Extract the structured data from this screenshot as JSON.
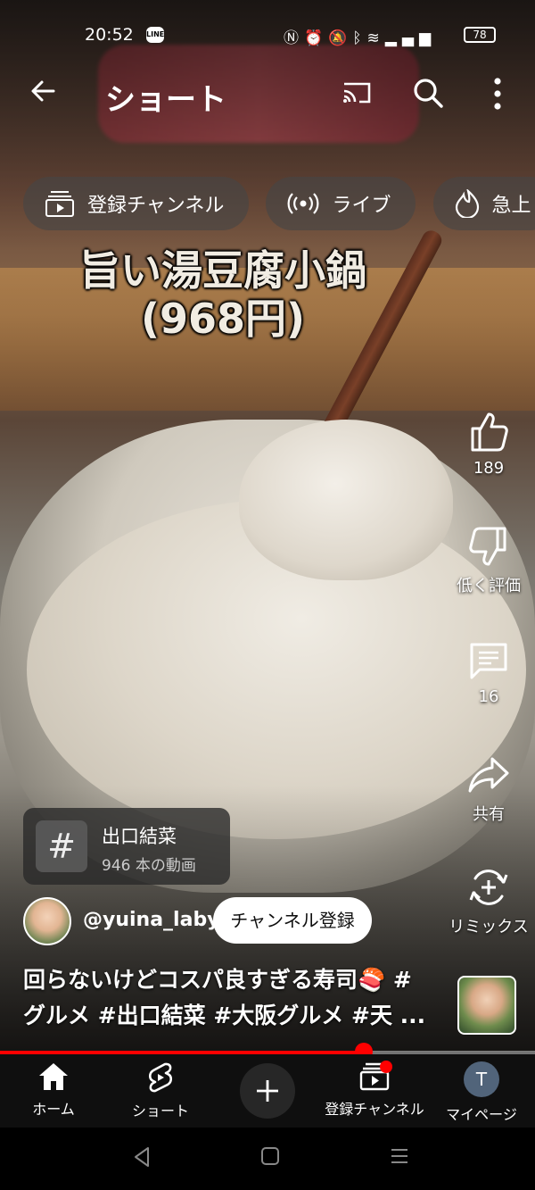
{
  "status_bar": {
    "time": "20:52",
    "line_badge": "LINE",
    "icons": [
      "nfc-icon",
      "alarm-icon",
      "mute-icon",
      "bluetooth-icon",
      "wifi-icon",
      "volte-icon",
      "signal-icon"
    ],
    "battery": "78"
  },
  "header": {
    "title": "ショート",
    "icons": [
      "back-arrow-icon",
      "cast-icon",
      "search-icon",
      "more-vert-icon"
    ]
  },
  "chips": [
    {
      "label": "登録チャンネル",
      "icon": "subscriptions-icon"
    },
    {
      "label": "ライブ",
      "icon": "live-icon"
    },
    {
      "label": "急上",
      "icon": "trending-flame-icon"
    }
  ],
  "video": {
    "overlay_title_line1": "旨い湯豆腐小鍋",
    "overlay_title_line2": "(968円)"
  },
  "actions": {
    "like": {
      "count": "189"
    },
    "dislike": {
      "label": "低く評価"
    },
    "comments": {
      "count": "16"
    },
    "share": {
      "label": "共有"
    },
    "remix": {
      "label": "リミックス"
    }
  },
  "hashtag_card": {
    "symbol": "#",
    "name": "出口結菜",
    "count": "946 本の動画"
  },
  "channel": {
    "handle": "@yuina_laby",
    "subscribe_label": "チャンネル登録"
  },
  "caption": {
    "line1": "回らないけどコスパ良すぎる寿司🍣 #",
    "line2": "グルメ #出口結菜 #大阪グルメ #天 ..."
  },
  "progress": {
    "fraction": 0.68
  },
  "nav": {
    "home": "ホーム",
    "shorts": "ショート",
    "subscriptions": "登録チャンネル",
    "me": "マイページ",
    "me_initial": "T"
  },
  "colors": {
    "accent": "#ff0000",
    "nav_bg": "#0f0f0f",
    "chip_bg": "#464646"
  }
}
